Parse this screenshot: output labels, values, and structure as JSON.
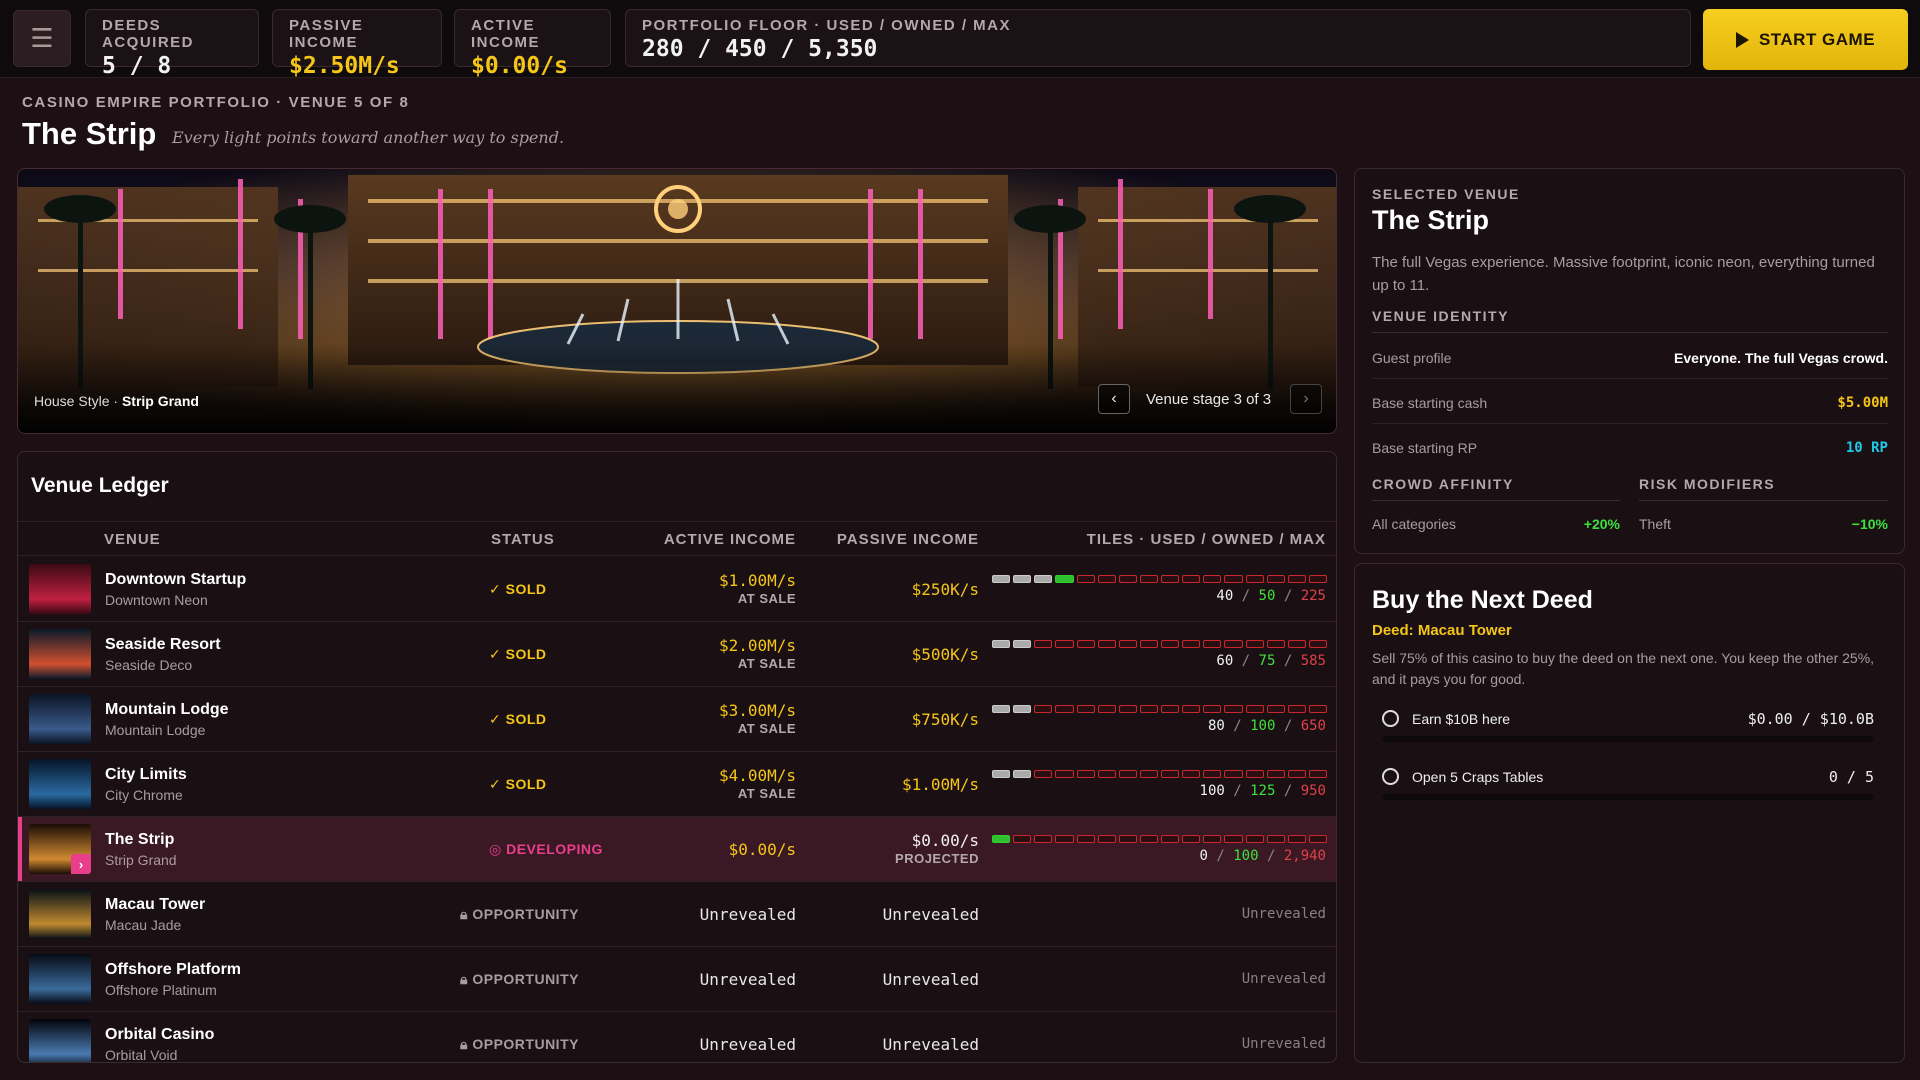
{
  "topbar": {
    "menu_icon": "hamburger-icon",
    "stats": [
      {
        "label": "DEEDS ACQUIRED",
        "value": "5 / 8",
        "accent": false
      },
      {
        "label": "PASSIVE INCOME",
        "value": "$2.50M/s",
        "accent": true
      },
      {
        "label": "ACTIVE INCOME",
        "value": "$0.00/s",
        "accent": true
      },
      {
        "label": "PORTFOLIO FLOOR · USED / OWNED / MAX",
        "value": "280 / 450 / 5,350",
        "accent": false
      }
    ],
    "start_label": "START GAME"
  },
  "header": {
    "crumb": "CASINO EMPIRE PORTFOLIO · VENUE 5 OF 8",
    "title": "The Strip",
    "tagline": "Every light points toward another way to spend."
  },
  "hero": {
    "caption_prefix": "House Style ·",
    "caption_style": "Strip Grand",
    "stage_label": "Venue stage 3 of 3"
  },
  "ledger": {
    "title": "Venue Ledger",
    "columns": {
      "venue": "VENUE",
      "status": "STATUS",
      "active": "ACTIVE INCOME",
      "passive": "PASSIVE INCOME",
      "tiles": "TILES · USED / OWNED / MAX"
    },
    "rows": [
      {
        "name": "Downtown Startup",
        "style": "Downtown Neon",
        "status": "SOLD",
        "active": "$1.00M/s",
        "active_sub": "AT SALE",
        "passive": "$250K/s",
        "passive_sub": "",
        "used": "40",
        "owned": "50",
        "max": "225",
        "tiles_used_frac": 0.178,
        "tiles_owned_frac": 0.222
      },
      {
        "name": "Seaside Resort",
        "style": "Seaside Deco",
        "status": "SOLD",
        "active": "$2.00M/s",
        "active_sub": "AT SALE",
        "passive": "$500K/s",
        "passive_sub": "",
        "used": "60",
        "owned": "75",
        "max": "585",
        "tiles_used_frac": 0.103,
        "tiles_owned_frac": 0.128
      },
      {
        "name": "Mountain Lodge",
        "style": "Mountain Lodge",
        "status": "SOLD",
        "active": "$3.00M/s",
        "active_sub": "AT SALE",
        "passive": "$750K/s",
        "passive_sub": "",
        "used": "80",
        "owned": "100",
        "max": "650",
        "tiles_used_frac": 0.123,
        "tiles_owned_frac": 0.154
      },
      {
        "name": "City Limits",
        "style": "City Chrome",
        "status": "SOLD",
        "active": "$4.00M/s",
        "active_sub": "AT SALE",
        "passive": "$1.00M/s",
        "passive_sub": "",
        "used": "100",
        "owned": "125",
        "max": "950",
        "tiles_used_frac": 0.105,
        "tiles_owned_frac": 0.132
      },
      {
        "name": "The Strip",
        "style": "Strip Grand",
        "status": "DEVELOPING",
        "active": "$0.00/s",
        "active_sub": "",
        "passive": "$0.00/s",
        "passive_sub": "PROJECTED",
        "used": "0",
        "owned": "100",
        "max": "2,940",
        "tiles_used_frac": 0.0,
        "tiles_owned_frac": 0.034
      },
      {
        "name": "Macau Tower",
        "style": "Macau Jade",
        "status": "OPPORTUNITY",
        "active": "Unrevealed",
        "active_sub": "",
        "passive": "Unrevealed",
        "passive_sub": "",
        "tiles_text": "Unrevealed"
      },
      {
        "name": "Offshore Platform",
        "style": "Offshore Platinum",
        "status": "OPPORTUNITY",
        "active": "Unrevealed",
        "active_sub": "",
        "passive": "Unrevealed",
        "passive_sub": "",
        "tiles_text": "Unrevealed"
      },
      {
        "name": "Orbital Casino",
        "style": "Orbital Void",
        "status": "OPPORTUNITY",
        "active": "Unrevealed",
        "active_sub": "",
        "passive": "Unrevealed",
        "passive_sub": "",
        "tiles_text": "Unrevealed"
      }
    ]
  },
  "selected": {
    "kicker": "SELECTED VENUE",
    "title": "The Strip",
    "description": "The full Vegas experience. Massive footprint, iconic neon, everything turned up to 11.",
    "identity_label": "VENUE IDENTITY",
    "guest_profile_label": "Guest profile",
    "guest_profile_value": "Everyone. The full Vegas crowd.",
    "cash_label": "Base starting cash",
    "cash_value": "$5.00M",
    "rp_label": "Base starting RP",
    "rp_value": "10 RP",
    "crowd_label": "CROWD AFFINITY",
    "crowd_key": "All categories",
    "crowd_value": "+20%",
    "risk_label": "RISK MODIFIERS",
    "risk_key": "Theft",
    "risk_value": "−10%"
  },
  "deed": {
    "title": "Buy the Next Deed",
    "deed_line": "Deed: Macau Tower",
    "description": "Sell 75% of this casino to buy the deed on the next one. You keep the other 25%, and it pays you for good.",
    "goals": [
      {
        "label": "Earn $10B here",
        "value": "$0.00 / $10.0B",
        "progress": 0.0
      },
      {
        "label": "Open 5 Craps Tables",
        "value": "0 / 5",
        "progress": 0.0
      }
    ]
  },
  "colors": {
    "accent_gold": "#f5c518",
    "accent_pink": "#e83e8c",
    "owned_green": "#3ee03e",
    "max_red": "#e04048",
    "cyan": "#22c8e8"
  }
}
